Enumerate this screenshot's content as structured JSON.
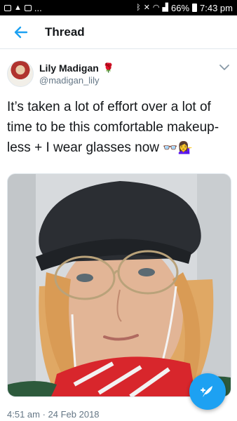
{
  "status_bar": {
    "battery": "66%",
    "time": "7:43 pm",
    "more": "..."
  },
  "app_bar": {
    "title": "Thread"
  },
  "tweet": {
    "author_name": "Lily Madigan",
    "author_emoji": "🌹",
    "handle": "@madigan_lily",
    "text_main": "It’s taken a lot of effort over a lot of time to be this comfortable makeup-less + I wear glasses now ",
    "text_emoji": "👓💁‍♀️",
    "timestamp": "4:51 am · 24 Feb 2018"
  },
  "icons": {
    "back": "arrow-left-icon",
    "menu": "chevron-down-icon",
    "compose": "feather-compose-icon"
  },
  "colors": {
    "accent": "#1da1f2",
    "secondary_text": "#657786"
  }
}
